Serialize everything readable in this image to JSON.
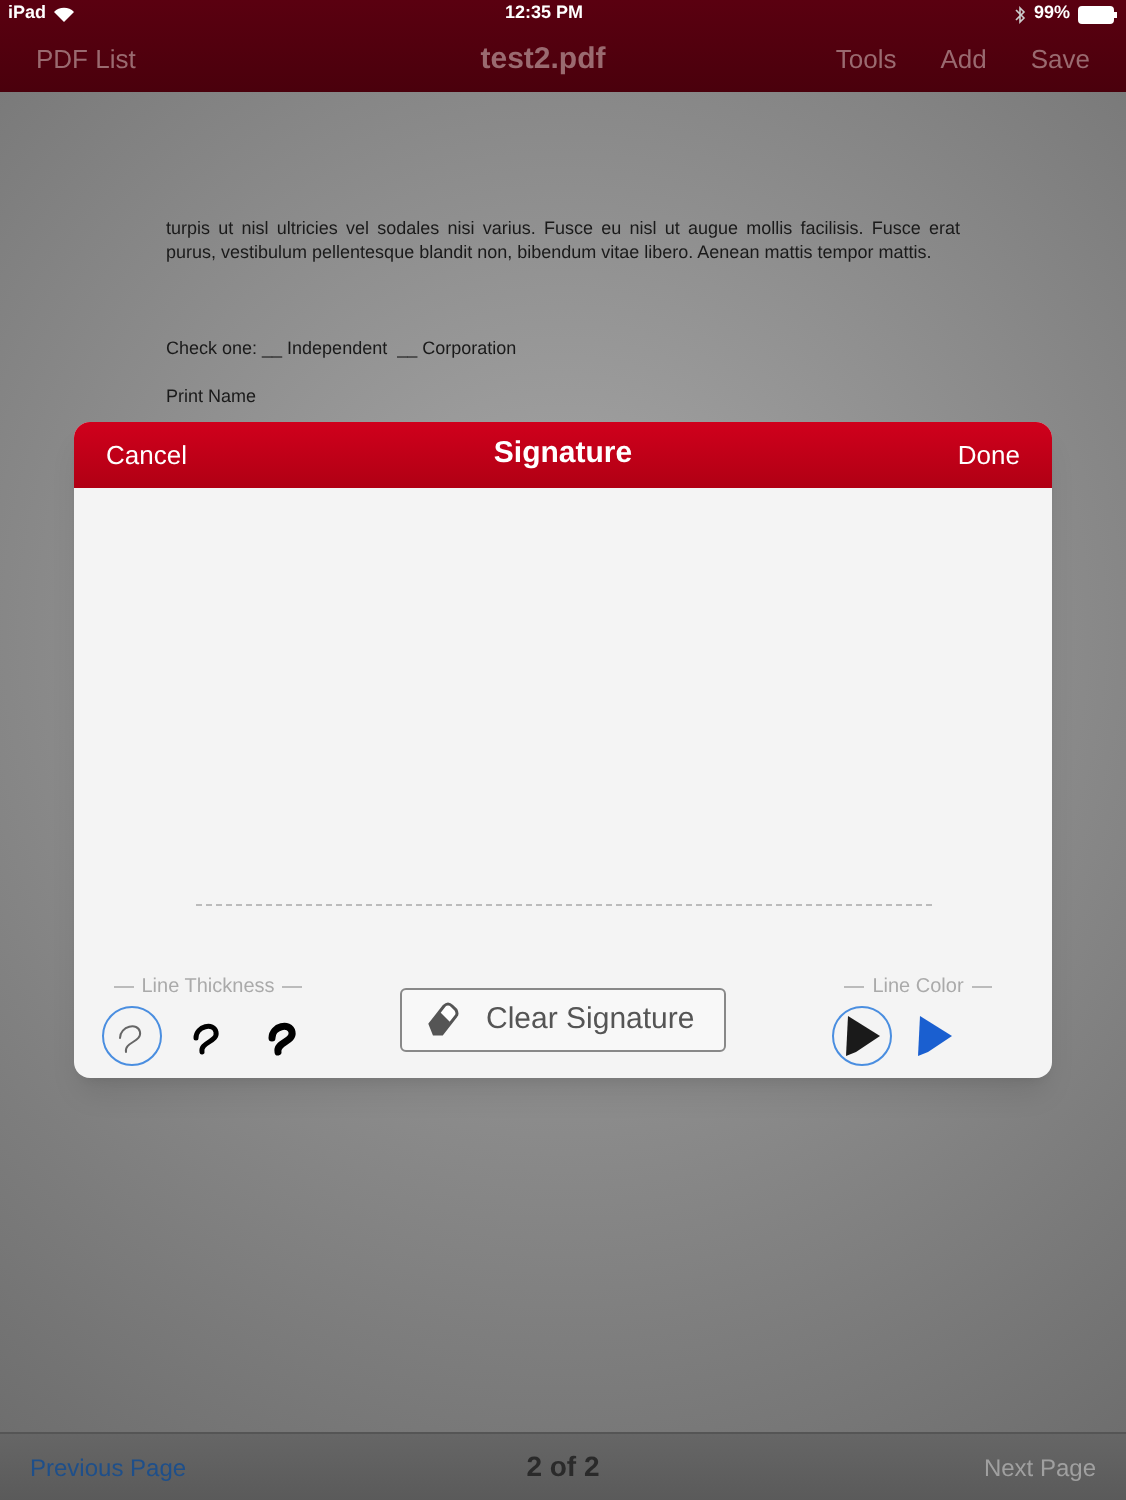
{
  "status_bar": {
    "device": "iPad",
    "time": "12:35 PM",
    "battery": "99%"
  },
  "nav_bar": {
    "left": "PDF List",
    "title": "test2.pdf",
    "actions": [
      {
        "label": "Tools",
        "disabled": true
      },
      {
        "label": "Add",
        "disabled": true
      },
      {
        "label": "Save",
        "disabled": true
      }
    ]
  },
  "document": {
    "paragraph": "turpis ut nisl ultricies vel sodales nisi varius. Fusce eu nisl ut augue mollis facilisis. Fusce erat purus, vestibulum pellentesque blandit non, bibendum vitae libero. Aenean mattis tempor mattis.",
    "check_line": "Check one: __ Independent  __ Corporation",
    "print_name": "Print Name"
  },
  "dialog": {
    "cancel": "Cancel",
    "title": "Signature",
    "done": "Done",
    "thickness_label": "Line Thickness",
    "thickness_options": [
      {
        "selected": true
      },
      {
        "selected": false
      },
      {
        "selected": false
      }
    ],
    "clear_button": "Clear Signature",
    "color_label": "Line Color",
    "color_options": [
      {
        "color": "#1a1a1a",
        "selected": true
      },
      {
        "color": "#1a5fd0",
        "selected": false
      }
    ]
  },
  "toolbar": {
    "previous": {
      "label": "Previous Page",
      "disabled": false
    },
    "page": "2 of 2",
    "next": {
      "label": "Next Page",
      "disabled": true
    }
  }
}
